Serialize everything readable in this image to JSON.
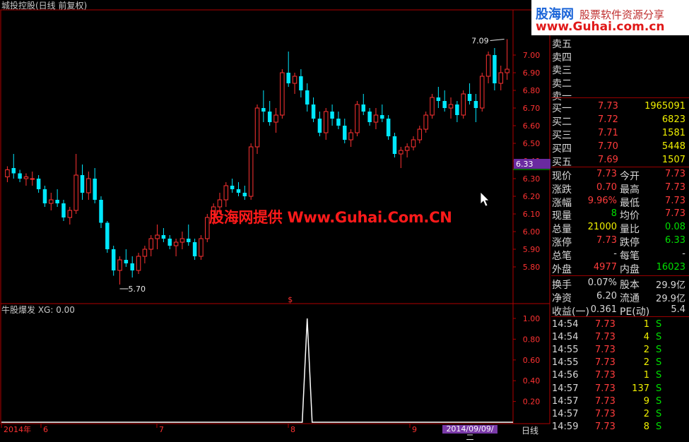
{
  "chart_title": "城投控股(日线 前复权)",
  "indicator_title": "牛股爆发  XG: 0.00",
  "watermark": "股海网提供  Www.Guhai.Com.CN",
  "logo": {
    "name": "股海网",
    "slogan": "股票软件资源分享",
    "url": "www.Guhai.com.cn"
  },
  "annotations": {
    "high_label": "7.09",
    "low_label": "5.70",
    "signal_mark": "$",
    "last_price_tag": "6.33"
  },
  "price_axis": [
    "7.00",
    "6.90",
    "6.80",
    "6.70",
    "6.60",
    "6.50",
    "6.40",
    "6.30",
    "6.20",
    "6.10",
    "6.00",
    "5.90",
    "5.80"
  ],
  "indicator_axis": [
    "1.00",
    "0.80",
    "0.60",
    "0.40",
    "0.20"
  ],
  "time_axis": {
    "labels": [
      "2014年",
      "6",
      "7",
      "8",
      "9"
    ],
    "current_date": "2014/09/09/二",
    "period": "日线"
  },
  "order_book": {
    "sell": [
      {
        "label": "卖五",
        "price": "",
        "vol": ""
      },
      {
        "label": "卖四",
        "price": "",
        "vol": ""
      },
      {
        "label": "卖三",
        "price": "",
        "vol": ""
      },
      {
        "label": "卖二",
        "price": "",
        "vol": ""
      },
      {
        "label": "卖一",
        "price": "",
        "vol": ""
      }
    ],
    "buy": [
      {
        "label": "买一",
        "price": "7.73",
        "vol": "1965091"
      },
      {
        "label": "买二",
        "price": "7.72",
        "vol": "6823"
      },
      {
        "label": "买三",
        "price": "7.71",
        "vol": "1581"
      },
      {
        "label": "买四",
        "price": "7.70",
        "vol": "5448"
      },
      {
        "label": "买五",
        "price": "7.69",
        "vol": "1507"
      }
    ]
  },
  "quote": [
    {
      "l1": "现价",
      "v1": "7.73",
      "c1": "red",
      "l2": "今开",
      "v2": "7.73",
      "c2": "red"
    },
    {
      "l1": "涨跌",
      "v1": "0.70",
      "c1": "red",
      "l2": "最高",
      "v2": "7.73",
      "c2": "red"
    },
    {
      "l1": "涨幅",
      "v1": "9.96%",
      "c1": "red",
      "l2": "最低",
      "v2": "7.73",
      "c2": "red"
    },
    {
      "l1": "现量",
      "v1": "8",
      "c1": "grn",
      "l2": "均价",
      "v2": "7.73",
      "c2": "red"
    },
    {
      "l1": "总量",
      "v1": "21000",
      "c1": "yel",
      "l2": "量比",
      "v2": "0.08",
      "c2": "grn"
    },
    {
      "l1": "涨停",
      "v1": "7.73",
      "c1": "red",
      "l2": "跌停",
      "v2": "6.33",
      "c2": "grn"
    },
    {
      "l1": "总笔",
      "v1": "-",
      "c1": "wht",
      "l2": "每笔",
      "v2": "-",
      "c2": "wht"
    },
    {
      "l1": "外盘",
      "v1": "4977",
      "c1": "red",
      "l2": "内盘",
      "v2": "16023",
      "c2": "grn"
    }
  ],
  "fundamentals": [
    {
      "l1": "换手",
      "v1": "0.07%",
      "l2": "股本",
      "v2": "29.9亿"
    },
    {
      "l1": "净资",
      "v1": "6.20",
      "l2": "流通",
      "v2": "29.9亿"
    },
    {
      "l1": "收益(一)",
      "v1": "0.361",
      "l2": "PE(动)",
      "v2": "5.4"
    }
  ],
  "ticks": [
    {
      "time": "14:54",
      "price": "7.73",
      "vol": "1",
      "side": "S"
    },
    {
      "time": "14:54",
      "price": "7.73",
      "vol": "4",
      "side": "S"
    },
    {
      "time": "14:55",
      "price": "7.73",
      "vol": "2",
      "side": "S"
    },
    {
      "time": "14:55",
      "price": "7.73",
      "vol": "2",
      "side": "S"
    },
    {
      "time": "14:56",
      "price": "7.73",
      "vol": "1",
      "side": "S"
    },
    {
      "time": "14:57",
      "price": "7.73",
      "vol": "137",
      "side": "S"
    },
    {
      "time": "14:57",
      "price": "7.73",
      "vol": "9",
      "side": "S"
    },
    {
      "time": "14:57",
      "price": "7.73",
      "vol": "2",
      "side": "S"
    },
    {
      "time": "14:59",
      "price": "7.73",
      "vol": "8",
      "side": "S"
    }
  ],
  "chart_data": {
    "type": "candlestick",
    "ylim": [
      5.7,
      7.12
    ],
    "candles": [
      [
        6.31,
        6.37,
        6.28,
        6.35
      ],
      [
        6.36,
        6.44,
        6.3,
        6.33
      ],
      [
        6.33,
        6.35,
        6.28,
        6.3
      ],
      [
        6.3,
        6.33,
        6.26,
        6.31
      ],
      [
        6.3,
        6.34,
        6.26,
        6.3
      ],
      [
        6.3,
        6.32,
        6.22,
        6.24
      ],
      [
        6.24,
        6.26,
        6.14,
        6.16
      ],
      [
        6.16,
        6.22,
        6.12,
        6.18
      ],
      [
        6.18,
        6.24,
        6.14,
        6.16
      ],
      [
        6.16,
        6.18,
        6.06,
        6.08
      ],
      [
        6.08,
        6.14,
        6.04,
        6.12
      ],
      [
        6.12,
        6.44,
        6.1,
        6.32
      ],
      [
        6.32,
        6.38,
        6.18,
        6.22
      ],
      [
        6.22,
        6.34,
        6.18,
        6.3
      ],
      [
        6.3,
        6.36,
        6.16,
        6.18
      ],
      [
        6.18,
        6.2,
        6.02,
        6.05
      ],
      [
        6.05,
        6.06,
        5.88,
        5.9
      ],
      [
        5.9,
        5.92,
        5.75,
        5.78
      ],
      [
        5.78,
        5.86,
        5.7,
        5.84
      ],
      [
        5.84,
        5.9,
        5.8,
        5.82
      ],
      [
        5.82,
        5.86,
        5.74,
        5.78
      ],
      [
        5.78,
        5.88,
        5.76,
        5.86
      ],
      [
        5.86,
        5.92,
        5.82,
        5.9
      ],
      [
        5.9,
        5.98,
        5.86,
        5.96
      ],
      [
        5.96,
        6.04,
        5.9,
        5.98
      ],
      [
        5.98,
        6.02,
        5.94,
        5.96
      ],
      [
        5.96,
        5.98,
        5.9,
        5.92
      ],
      [
        5.92,
        5.96,
        5.86,
        5.94
      ],
      [
        5.94,
        6.0,
        5.9,
        5.96
      ],
      [
        5.96,
        6.04,
        5.92,
        5.94
      ],
      [
        5.94,
        5.96,
        5.84,
        5.86
      ],
      [
        5.86,
        5.98,
        5.84,
        5.96
      ],
      [
        5.96,
        6.1,
        5.94,
        6.08
      ],
      [
        6.08,
        6.16,
        6.04,
        6.14
      ],
      [
        6.14,
        6.22,
        6.1,
        6.18
      ],
      [
        6.18,
        6.28,
        6.14,
        6.26
      ],
      [
        6.26,
        6.3,
        6.22,
        6.24
      ],
      [
        6.24,
        6.28,
        6.2,
        6.22
      ],
      [
        6.22,
        6.26,
        6.18,
        6.2
      ],
      [
        6.2,
        6.5,
        6.18,
        6.48
      ],
      [
        6.48,
        6.72,
        6.44,
        6.7
      ],
      [
        6.7,
        6.8,
        6.62,
        6.68
      ],
      [
        6.68,
        6.74,
        6.6,
        6.62
      ],
      [
        6.62,
        6.7,
        6.56,
        6.66
      ],
      [
        6.66,
        6.92,
        6.64,
        6.9
      ],
      [
        6.9,
        7.02,
        6.82,
        6.84
      ],
      [
        6.84,
        6.9,
        6.78,
        6.88
      ],
      [
        6.88,
        6.92,
        6.76,
        6.8
      ],
      [
        6.8,
        6.84,
        6.68,
        6.72
      ],
      [
        6.72,
        6.76,
        6.62,
        6.64
      ],
      [
        6.64,
        6.68,
        6.54,
        6.56
      ],
      [
        6.56,
        6.7,
        6.52,
        6.68
      ],
      [
        6.68,
        6.72,
        6.6,
        6.64
      ],
      [
        6.64,
        6.68,
        6.58,
        6.6
      ],
      [
        6.6,
        6.64,
        6.5,
        6.52
      ],
      [
        6.52,
        6.58,
        6.48,
        6.56
      ],
      [
        6.56,
        6.74,
        6.54,
        6.72
      ],
      [
        6.72,
        6.78,
        6.66,
        6.68
      ],
      [
        6.68,
        6.7,
        6.6,
        6.62
      ],
      [
        6.62,
        6.7,
        6.58,
        6.66
      ],
      [
        6.66,
        6.72,
        6.62,
        6.64
      ],
      [
        6.64,
        6.66,
        6.52,
        6.54
      ],
      [
        6.54,
        6.56,
        6.42,
        6.44
      ],
      [
        6.44,
        6.48,
        6.36,
        6.46
      ],
      [
        6.46,
        6.5,
        6.42,
        6.48
      ],
      [
        6.48,
        6.54,
        6.46,
        6.52
      ],
      [
        6.52,
        6.6,
        6.5,
        6.58
      ],
      [
        6.58,
        6.68,
        6.56,
        6.66
      ],
      [
        6.66,
        6.78,
        6.64,
        6.76
      ],
      [
        6.76,
        6.82,
        6.7,
        6.74
      ],
      [
        6.74,
        6.8,
        6.68,
        6.7
      ],
      [
        6.7,
        6.76,
        6.64,
        6.72
      ],
      [
        6.72,
        6.74,
        6.62,
        6.66
      ],
      [
        6.66,
        6.8,
        6.64,
        6.78
      ],
      [
        6.78,
        6.84,
        6.72,
        6.74
      ],
      [
        6.74,
        6.78,
        6.62,
        6.7
      ],
      [
        6.7,
        6.9,
        6.68,
        6.88
      ],
      [
        6.88,
        7.02,
        6.84,
        7.0
      ],
      [
        7.0,
        7.04,
        6.8,
        6.84
      ],
      [
        6.84,
        6.94,
        6.8,
        6.9
      ],
      [
        6.9,
        7.09,
        6.86,
        6.92
      ]
    ],
    "indicator": {
      "name": "XG",
      "spike_index": 48,
      "spike_value": 1.0
    }
  }
}
